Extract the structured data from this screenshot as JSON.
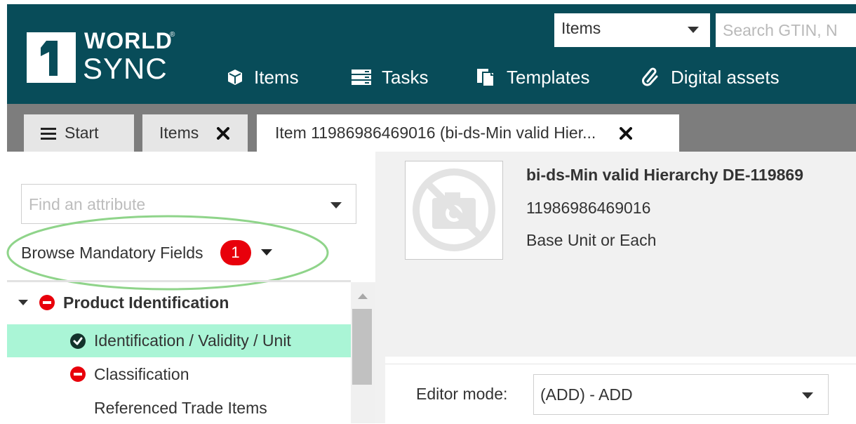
{
  "brand": {
    "line1": "WORLD",
    "line2": "SYNC",
    "mark": "1",
    "reg": "®",
    "header_color": "#084c59"
  },
  "search": {
    "scope_value": "Items",
    "placeholder": "Search GTIN, N"
  },
  "nav": [
    {
      "label": "Items",
      "icon": "cube-icon"
    },
    {
      "label": "Tasks",
      "icon": "list-icon"
    },
    {
      "label": "Templates",
      "icon": "document-stack-icon"
    },
    {
      "label": "Digital assets",
      "icon": "paperclip-icon"
    }
  ],
  "tabs": {
    "start": "Start",
    "items": "Items",
    "item": "Item 11986986469016 (bi-ds-Min valid Hier..."
  },
  "sidebar": {
    "find_placeholder": "Find an attribute",
    "browse_label": "Browse Mandatory Fields",
    "browse_count": "1",
    "annotation_color": "#8fd48a",
    "tree": [
      {
        "label": "Product Identification",
        "status": "error",
        "expanded": true
      },
      {
        "label": "Identification / Validity / Unit",
        "status": "ok",
        "selected": true
      },
      {
        "label": "Classification",
        "status": "error"
      },
      {
        "label": "Referenced Trade Items",
        "status": "none"
      }
    ]
  },
  "item": {
    "title": "bi-ds-Min valid Hierarchy DE-119869",
    "gtin": "11986986469016",
    "unit": "Base Unit or Each",
    "image": "no-image-icon"
  },
  "editor": {
    "label": "Editor mode:",
    "value": "(ADD) - ADD"
  },
  "colors": {
    "error": "#e8000b",
    "ok": "#13332c",
    "selected_row": "#aaf5d6",
    "tab_strip": "#7d7d7d"
  }
}
